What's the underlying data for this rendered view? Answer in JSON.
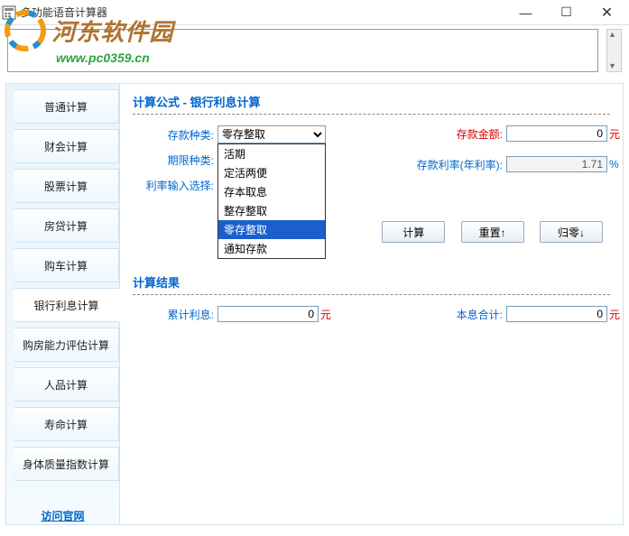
{
  "window": {
    "title": "多功能语音计算器",
    "minimize": "—",
    "maximize": "☐",
    "close": "✕"
  },
  "watermark": {
    "brand": "河东软件园",
    "url": "www.pc0359.cn"
  },
  "tabs": {
    "items": [
      {
        "label": "普通计算"
      },
      {
        "label": "财会计算"
      },
      {
        "label": "股票计算"
      },
      {
        "label": "房贷计算"
      },
      {
        "label": "购车计算"
      },
      {
        "label": "银行利息计算"
      },
      {
        "label": "购房能力评估计算"
      },
      {
        "label": "人品计算"
      },
      {
        "label": "寿命计算"
      },
      {
        "label": "身体质量指数计算"
      }
    ],
    "visit_link": "访问官网",
    "active_index": 5
  },
  "formula": {
    "title": "计算公式 - 银行利息计算",
    "deposit_type_label": "存款种类:",
    "deposit_type_value": "零存整取",
    "deposit_type_options": [
      "活期",
      "定活两便",
      "存本取息",
      "整存整取",
      "零存整取",
      "通知存款"
    ],
    "selected_option_index": 4,
    "term_type_label": "期限种类:",
    "rate_input_label": "利率输入选择:",
    "amount_label": "存款金额:",
    "amount_value": "0",
    "amount_unit": "元",
    "rate_label": "存款利率(年利率):",
    "rate_value": "1.71",
    "rate_unit": "%"
  },
  "buttons": {
    "calc": "计算",
    "reset": "重置↑",
    "zero": "归零↓"
  },
  "result": {
    "title": "计算结果",
    "interest_label": "累计利息:",
    "interest_value": "0",
    "interest_unit": "元",
    "total_label": "本息合计:",
    "total_value": "0",
    "total_unit": "元"
  }
}
